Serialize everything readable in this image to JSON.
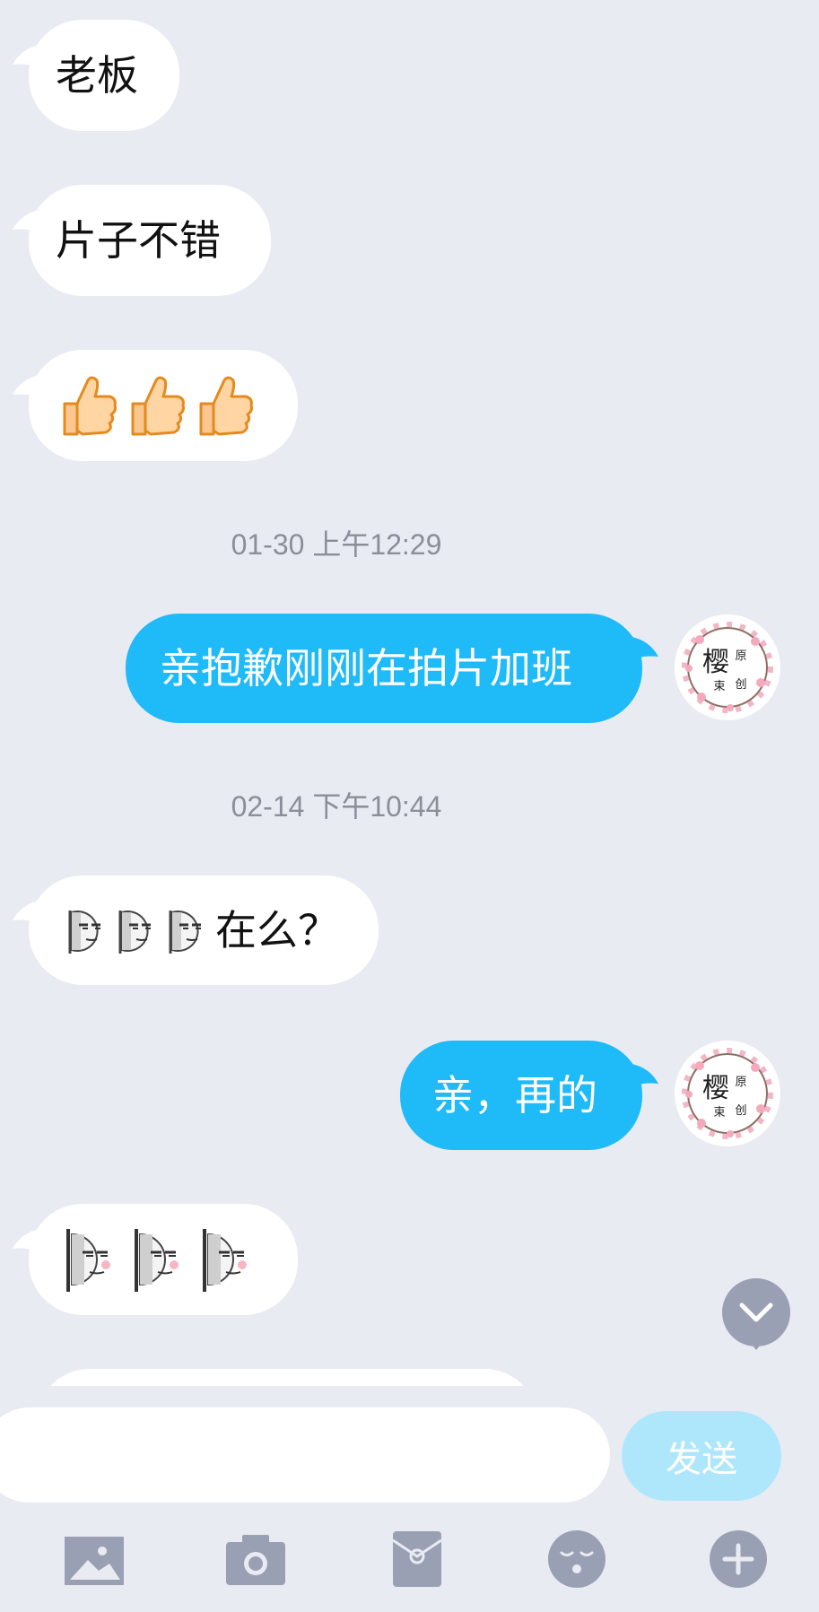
{
  "messages": [
    {
      "side": "in",
      "text": "老板"
    },
    {
      "side": "in",
      "text": "片子不错"
    },
    {
      "side": "in",
      "text": "👍👍👍"
    },
    {
      "side": "out",
      "text": "亲抱歉刚刚在拍片加班"
    },
    {
      "side": "in",
      "text": "在么？"
    },
    {
      "side": "out",
      "text": "亲，再的"
    }
  ],
  "timestamps": [
    "01-30 上午12:29",
    "02-14 下午10:44"
  ],
  "avatar": {
    "char_main": "樱",
    "char_a": "原",
    "char_b": "束",
    "char_c": "创"
  },
  "input": {
    "value": "",
    "placeholder": ""
  },
  "send_label": "发送",
  "toolbar": [
    "image-icon",
    "camera-icon",
    "red-packet-icon",
    "emoji-icon",
    "plus-icon"
  ],
  "colors": {
    "background": "#e9ebf2",
    "outgoing_bubble": "#1fbaf8",
    "incoming_bubble": "#ffffff",
    "send_disabled": "#aee7fb",
    "icon": "#9aa0b4"
  }
}
